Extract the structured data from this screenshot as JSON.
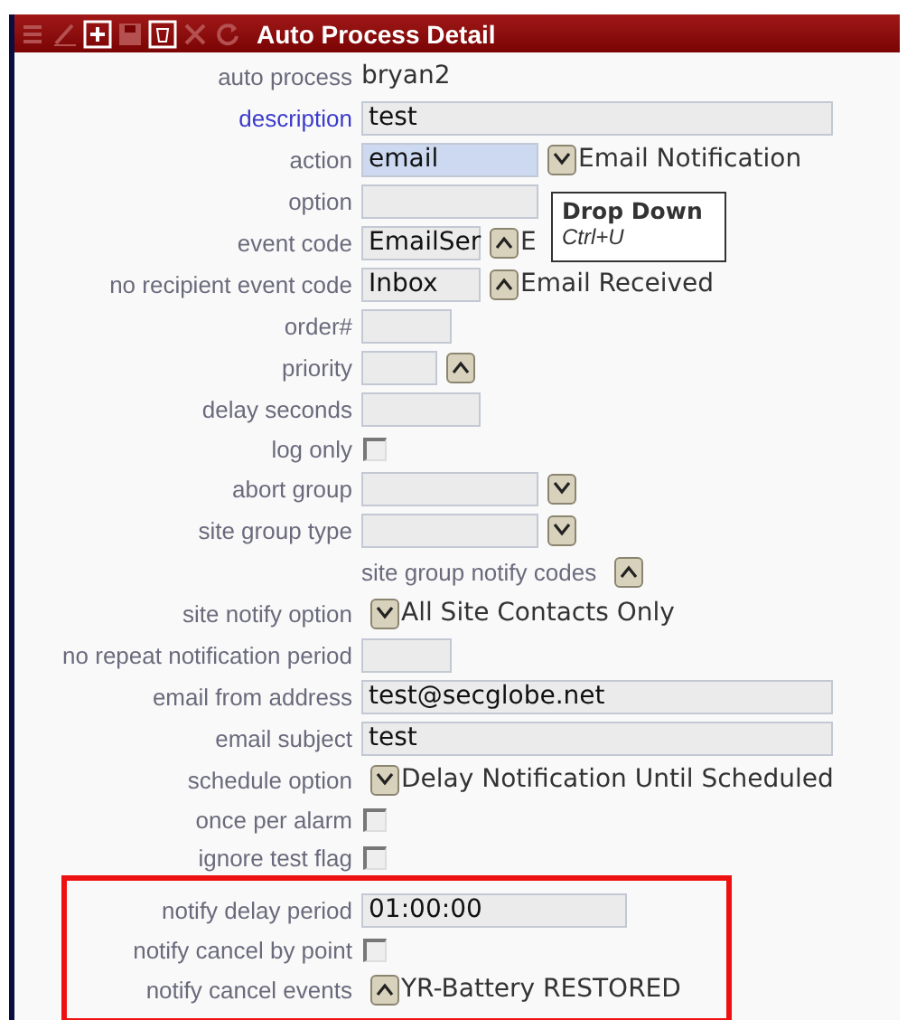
{
  "window": {
    "title": "Auto Process Detail"
  },
  "toolbar": [
    {
      "kind": "list",
      "disabled": true
    },
    {
      "kind": "edit",
      "disabled": true
    },
    {
      "kind": "add",
      "disabled": false
    },
    {
      "kind": "save",
      "disabled": true
    },
    {
      "kind": "trash",
      "disabled": false
    },
    {
      "kind": "delete",
      "disabled": true
    },
    {
      "kind": "refresh",
      "disabled": true
    }
  ],
  "rows": [
    {
      "label": "auto process",
      "kind": "text",
      "value": "bryan2"
    },
    {
      "label": "description",
      "kind": "field",
      "focused": true,
      "field": {
        "value": "test",
        "kind": "wide",
        "highlighted": false
      }
    },
    {
      "label": "action",
      "kind": "field",
      "field": {
        "value": "email",
        "kind": "medium",
        "highlighted": true
      },
      "button": {
        "kind": "down"
      },
      "extra": "Email Notification"
    },
    {
      "label": "option",
      "kind": "field",
      "field": {
        "kind": "medium",
        "highlighted": false
      }
    },
    {
      "label": "event code",
      "kind": "field",
      "field": {
        "value": "EmailSer",
        "kind": "small",
        "highlighted": false
      },
      "button": {
        "kind": "up"
      },
      "extra": "E"
    },
    {
      "label": "no recipient event code",
      "kind": "field",
      "field": {
        "value": "Inbox",
        "kind": "small",
        "highlighted": false
      },
      "button": {
        "kind": "up"
      },
      "extra": "Email Received"
    },
    {
      "label": "order#",
      "kind": "field",
      "field": {
        "kind": "xsmall",
        "highlighted": false
      }
    },
    {
      "label": "priority",
      "kind": "field",
      "field": {
        "kind": "tiny",
        "highlighted": false
      },
      "button": {
        "kind": "up"
      }
    },
    {
      "label": "delay seconds",
      "kind": "field",
      "field": {
        "kind": "small",
        "highlighted": false
      }
    },
    {
      "label": "log only",
      "kind": "checkbox",
      "checked": false
    },
    {
      "label": "abort group",
      "kind": "field",
      "field": {
        "kind": "medium",
        "highlighted": false
      },
      "button": {
        "kind": "down"
      }
    },
    {
      "label": "site group type",
      "kind": "field",
      "field": {
        "kind": "medium",
        "highlighted": false
      },
      "button": {
        "kind": "down"
      }
    },
    {
      "kind": "sublabel",
      "value": "site group notify codes",
      "button": {
        "kind": "up"
      }
    },
    {
      "label": "site notify option",
      "kind": "choice",
      "button": {
        "kind": "down"
      },
      "extra": "All Site Contacts Only"
    },
    {
      "label": "no repeat notification period",
      "kind": "field",
      "field": {
        "kind": "xsmall",
        "highlighted": false
      }
    },
    {
      "label": "email from address",
      "kind": "field",
      "field": {
        "value": "test@secglobe.net",
        "kind": "wide",
        "highlighted": false
      }
    },
    {
      "label": "email subject",
      "kind": "field",
      "field": {
        "value": "test",
        "kind": "wide",
        "highlighted": false
      }
    },
    {
      "label": "schedule option",
      "kind": "choice",
      "button": {
        "kind": "down"
      },
      "extra": "Delay Notification Until Scheduled"
    },
    {
      "label": "once per alarm",
      "kind": "checkbox",
      "checked": false
    },
    {
      "label": "ignore test flag",
      "kind": "checkbox",
      "checked": false
    }
  ],
  "callout": {
    "rows": [
      {
        "label": "notify delay period",
        "kind": "field",
        "field": {
          "value": "01:00:00",
          "kind": "large",
          "highlighted": false
        }
      },
      {
        "label": "notify cancel by point",
        "kind": "checkbox",
        "checked": false
      },
      {
        "label": "notify cancel events",
        "kind": "choice",
        "button": {
          "kind": "up"
        },
        "extra": "YR-Battery RESTORED"
      }
    ]
  },
  "tooltip": {
    "title": "Drop Down",
    "shortcut": "Ctrl+U"
  }
}
